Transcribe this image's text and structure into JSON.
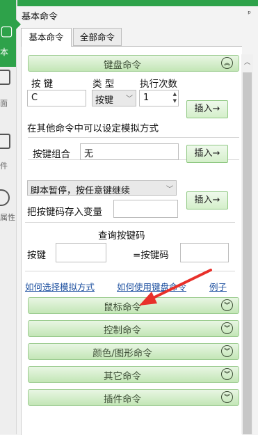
{
  "left": {
    "active_label": "本",
    "items": [
      {
        "label": "面"
      },
      {
        "label": "件"
      },
      {
        "label": "属性"
      }
    ]
  },
  "panel": {
    "title": "基本命令",
    "pin": "ᵖ",
    "tabs": [
      {
        "label": "基本命令",
        "active": true
      },
      {
        "label": "全部命令",
        "active": false
      }
    ]
  },
  "keyboard": {
    "header": "键盘命令",
    "col_key": "按 键",
    "col_type": "类 型",
    "col_count": "执行次数",
    "key_value": "C",
    "type_value": "按键",
    "count_value": "1",
    "insert_label": "插入→",
    "note": "在其他命令中可以设定模拟方式",
    "combo_label": "按键组合",
    "combo_value": "无",
    "pause_option": "脚本暂停，按任意键继续",
    "save_var_label": "把按键码存入变量",
    "save_var_value": "",
    "query_title": "查询按键码",
    "query_key_label": "按键",
    "query_key_value": "",
    "query_code_label": "=按键码",
    "query_code_value": ""
  },
  "links": [
    {
      "label": "如何选择模拟方式"
    },
    {
      "label": "如何使用键盘命令"
    },
    {
      "label": "例子"
    }
  ],
  "sections": [
    {
      "label": "鼠标命令"
    },
    {
      "label": "控制命令"
    },
    {
      "label": "颜色/图形命令"
    },
    {
      "label": "其它命令"
    },
    {
      "label": "插件命令"
    }
  ],
  "icons": {
    "collapse": "chevron-up-double",
    "expand": "chevron-down-double"
  },
  "colors": {
    "accent": "#2ea24a",
    "section_bg": "#c3e6b6",
    "link": "#1d50a0",
    "annotation_arrow": "#e8302a"
  }
}
